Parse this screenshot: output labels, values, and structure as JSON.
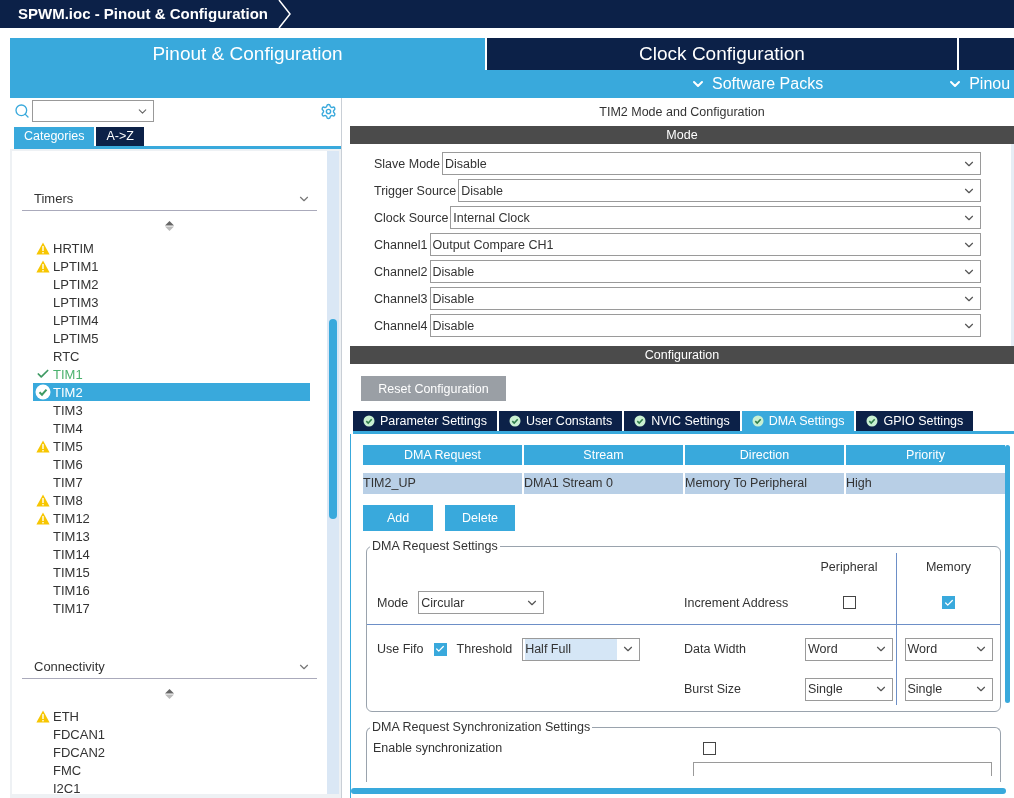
{
  "title_bar": {
    "title": "SPWM.ioc - Pinout & Configuration"
  },
  "main_tabs": [
    {
      "label": "Pinout & Configuration",
      "selected": true
    },
    {
      "label": "Clock Configuration",
      "selected": false
    }
  ],
  "sub_menu": [
    {
      "label": "Software Packs"
    },
    {
      "label": "Pinou"
    }
  ],
  "sidebar": {
    "tabs": [
      {
        "label": "Categories",
        "selected": true
      },
      {
        "label": "A->Z",
        "selected": false
      }
    ],
    "categories": [
      {
        "name": "Timers",
        "expanded": true,
        "items": [
          {
            "label": "HRTIM",
            "warning": true,
            "configured": false,
            "selected": false
          },
          {
            "label": "LPTIM1",
            "warning": true,
            "configured": false,
            "selected": false
          },
          {
            "label": "LPTIM2",
            "warning": false,
            "configured": false,
            "selected": false
          },
          {
            "label": "LPTIM3",
            "warning": false,
            "configured": false,
            "selected": false
          },
          {
            "label": "LPTIM4",
            "warning": false,
            "configured": false,
            "selected": false
          },
          {
            "label": "LPTIM5",
            "warning": false,
            "configured": false,
            "selected": false
          },
          {
            "label": "RTC",
            "warning": false,
            "configured": false,
            "selected": false
          },
          {
            "label": "TIM1",
            "warning": false,
            "configured": true,
            "selected": false
          },
          {
            "label": "TIM2",
            "warning": false,
            "configured": true,
            "selected": true
          },
          {
            "label": "TIM3",
            "warning": false,
            "configured": false,
            "selected": false
          },
          {
            "label": "TIM4",
            "warning": false,
            "configured": false,
            "selected": false
          },
          {
            "label": "TIM5",
            "warning": true,
            "configured": false,
            "selected": false
          },
          {
            "label": "TIM6",
            "warning": false,
            "configured": false,
            "selected": false
          },
          {
            "label": "TIM7",
            "warning": false,
            "configured": false,
            "selected": false
          },
          {
            "label": "TIM8",
            "warning": true,
            "configured": false,
            "selected": false
          },
          {
            "label": "TIM12",
            "warning": true,
            "configured": false,
            "selected": false
          },
          {
            "label": "TIM13",
            "warning": false,
            "configured": false,
            "selected": false
          },
          {
            "label": "TIM14",
            "warning": false,
            "configured": false,
            "selected": false
          },
          {
            "label": "TIM15",
            "warning": false,
            "configured": false,
            "selected": false
          },
          {
            "label": "TIM16",
            "warning": false,
            "configured": false,
            "selected": false
          },
          {
            "label": "TIM17",
            "warning": false,
            "configured": false,
            "selected": false
          }
        ]
      },
      {
        "name": "Connectivity",
        "expanded": true,
        "items": [
          {
            "label": "ETH",
            "warning": true,
            "configured": false,
            "selected": false
          },
          {
            "label": "FDCAN1",
            "warning": false,
            "configured": false,
            "selected": false
          },
          {
            "label": "FDCAN2",
            "warning": false,
            "configured": false,
            "selected": false
          },
          {
            "label": "FMC",
            "warning": false,
            "configured": false,
            "selected": false
          },
          {
            "label": "I2C1",
            "warning": false,
            "configured": false,
            "selected": false
          }
        ]
      }
    ]
  },
  "mode": {
    "title": "TIM2 Mode and Configuration",
    "header": "Mode",
    "rows": [
      {
        "label": "Slave Mode",
        "value": "Disable"
      },
      {
        "label": "Trigger Source",
        "value": "Disable"
      },
      {
        "label": "Clock Source",
        "value": "Internal Clock"
      },
      {
        "label": "Channel1",
        "value": "Output Compare CH1"
      },
      {
        "label": "Channel2",
        "value": "Disable"
      },
      {
        "label": "Channel3",
        "value": "Disable"
      },
      {
        "label": "Channel4",
        "value": "Disable"
      }
    ]
  },
  "configuration": {
    "header": "Configuration",
    "reset_button": "Reset Configuration",
    "tabs": [
      {
        "label": "Parameter Settings",
        "selected": false
      },
      {
        "label": "User Constants",
        "selected": false
      },
      {
        "label": "NVIC Settings",
        "selected": false
      },
      {
        "label": "DMA Settings",
        "selected": true
      },
      {
        "label": "GPIO Settings",
        "selected": false
      }
    ],
    "dma_table": {
      "columns": [
        "DMA Request",
        "Stream",
        "Direction",
        "Priority"
      ],
      "rows": [
        {
          "cells": [
            "TIM2_UP",
            "DMA1 Stream 0",
            "Memory To Peripheral",
            "High"
          ],
          "selected": true
        }
      ]
    },
    "buttons": [
      "Add",
      "Delete"
    ],
    "request_settings": {
      "legend": "DMA Request Settings",
      "peripheral_header": "Peripheral",
      "memory_header": "Memory",
      "mode": {
        "label": "Mode",
        "value": "Circular"
      },
      "increment_address": {
        "label": "Increment Address",
        "peripheral_checked": false,
        "memory_checked": true
      },
      "use_fifo": {
        "label": "Use Fifo",
        "checked": true
      },
      "threshold": {
        "label": "Threshold",
        "value": "Half Full",
        "highlighted": true
      },
      "data_width": {
        "label": "Data Width",
        "peripheral": "Word",
        "memory": "Word"
      },
      "burst_size": {
        "label": "Burst Size",
        "peripheral": "Single",
        "memory": "Single"
      }
    },
    "sync_settings": {
      "legend": "DMA Request Synchronization Settings",
      "enable_sync": {
        "label": "Enable synchronization",
        "checked": false
      }
    }
  }
}
